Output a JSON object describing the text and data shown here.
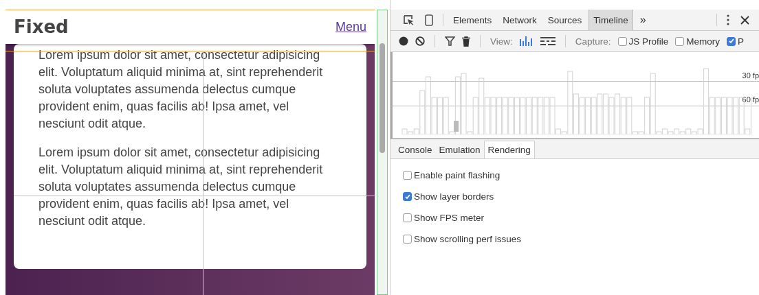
{
  "page": {
    "header": {
      "title": "Fixed",
      "menu_link": "Menu"
    },
    "cards": [
      {
        "paragraphs": [
          "Lorem ipsum dolor sit amet, consectetur adipisicing elit. Voluptatum aliquid minima at, sint reprehenderit soluta voluptates assumenda delectus cumque provident enim, quas facilis ab! Ipsa amet, vel nesciunt odit atque.",
          "Lorem ipsum dolor sit amet, consectetur adipisicing elit. Voluptatum aliquid minima at, sint reprehenderit soluta voluptates assumenda delectus cumque provident enim, quas facilis ab! Ipsa amet, vel nesciunt odit atque."
        ]
      }
    ]
  },
  "devtools": {
    "tabs": [
      {
        "label": "Elements",
        "selected": false
      },
      {
        "label": "Network",
        "selected": false
      },
      {
        "label": "Sources",
        "selected": false
      },
      {
        "label": "Timeline",
        "selected": true
      }
    ],
    "overflow": "»",
    "view_label": "View:",
    "view_modes": [
      {
        "kind": "bars",
        "selected": true
      },
      {
        "kind": "stripes",
        "selected": false
      }
    ],
    "capture_label": "Capture:",
    "capture_options": [
      {
        "label": "JS Profile",
        "checked": false
      },
      {
        "label": "Memory",
        "checked": false
      },
      {
        "label": "P",
        "checked": true
      }
    ],
    "fps_labels": [
      "30 fp",
      "60 fp"
    ],
    "drawer_tabs": [
      {
        "label": "Console",
        "selected": false
      },
      {
        "label": "Emulation",
        "selected": false
      },
      {
        "label": "Rendering",
        "selected": true
      }
    ],
    "rendering_options": [
      {
        "label": "Enable paint flashing",
        "checked": false
      },
      {
        "label": "Show layer borders",
        "checked": true
      },
      {
        "label": "Show FPS meter",
        "checked": false
      },
      {
        "label": "Show scrolling perf issues",
        "checked": false
      }
    ]
  }
}
